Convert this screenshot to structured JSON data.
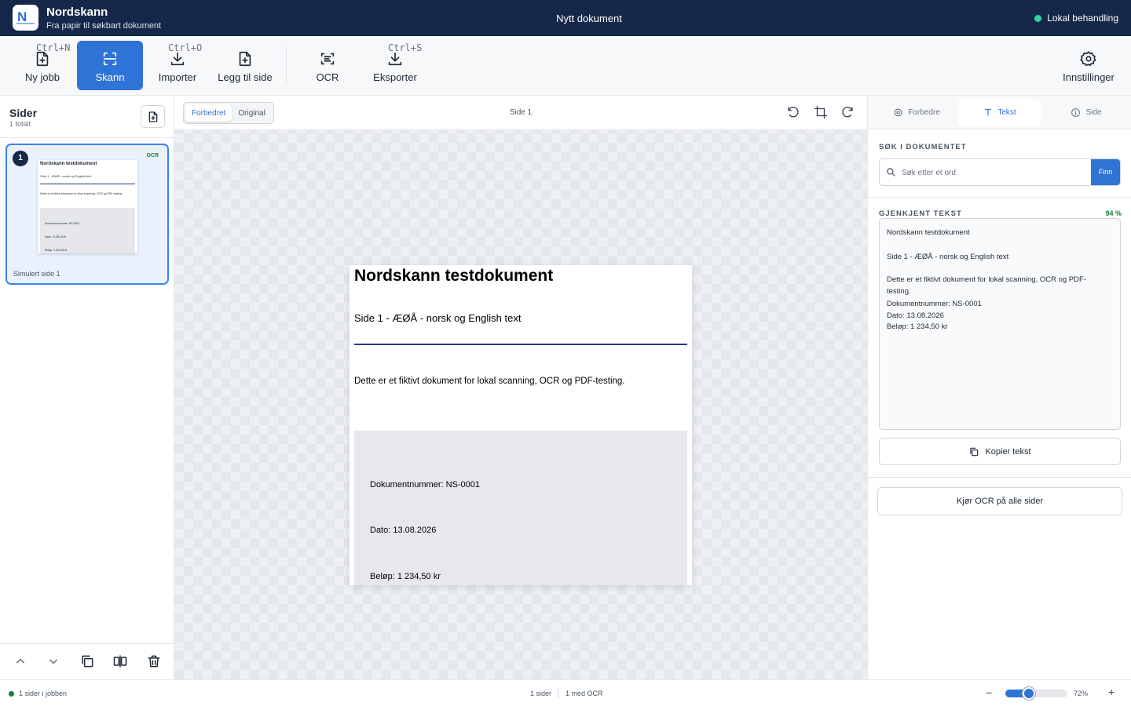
{
  "app": {
    "name": "Nordskann",
    "subtitle": "Fra papir til søkbart dokument",
    "logo_text": "N"
  },
  "document_title": "Nytt dokument",
  "local_status": "Lokal behandling",
  "colors": {
    "titlebar": "#16284a",
    "accent": "#2e73d6",
    "status_green": "#34d399",
    "ocr_badge": "#15803d"
  },
  "toolbar": {
    "new_job": {
      "label": "Ny jobb",
      "shortcut": "Ctrl+N",
      "icon": "file-plus-icon"
    },
    "scan": {
      "label": "Skann",
      "icon": "scan-icon",
      "active": true
    },
    "import": {
      "label": "Importer",
      "shortcut": "Ctrl+O",
      "icon": "download-icon"
    },
    "add_page": {
      "label": "Legg til side",
      "icon": "file-plus-icon"
    },
    "ocr": {
      "label": "OCR",
      "icon": "text-scan-icon"
    },
    "export": {
      "label": "Eksporter",
      "shortcut": "Ctrl+S",
      "icon": "download-icon"
    },
    "settings": {
      "label": "Innstillinger",
      "icon": "gear-icon"
    }
  },
  "pages_panel": {
    "title": "Sider",
    "count": "1 totalt",
    "pages": [
      {
        "number": "1",
        "badge": "OCR",
        "label": "Simulert side 1",
        "thumb_title": "Nordskann testdokument",
        "thumb_sub": "Side 1 - ÆØÅ - norsk og English text",
        "thumb_body": "Dette er et fiktivt dokument for lokal scanning, OCR og PDF-testing.",
        "thumb_doc": "Dokumentnummer: NS-0001",
        "thumb_date": "Dato: 13.08.2026",
        "thumb_amount": "Beløp: 1 234,50 kr"
      }
    ]
  },
  "viewer": {
    "views": [
      "Forbedret",
      "Original"
    ],
    "active_view": "Forbedret",
    "page_label": "Side 1",
    "document": {
      "title": "Nordskann testdokument",
      "subtitle": "Side 1 - ÆØÅ - norsk og English text",
      "body": "Dette er et fiktivt dokument for lokal scanning, OCR og PDF-testing.",
      "doc_number": "Dokumentnummer: NS-0001",
      "date": "Dato: 13.08.2026",
      "amount": "Beløp: 1 234,50 kr"
    }
  },
  "right_panel": {
    "tabs": [
      "Forbedre",
      "Tekst",
      "Side"
    ],
    "active_tab": "Tekst",
    "search_heading": "SØK I DOKUMENTET",
    "search_placeholder": "Søk etter et ord",
    "search_button": "Finn",
    "recognized_heading": "GJENKJENT TEKST",
    "confidence": "94 %",
    "ocr_text": {
      "l1": "Nordskann testdokument",
      "l2": "Side 1 - ÆØÅ - norsk og English text",
      "l3": "Dette er et fiktivt dokument for lokal scanning, OCR og PDF-",
      "l4": "testing.",
      "l5": "Dokumentnummer: NS-0001",
      "l6": "Dato: 13.08.2026",
      "l7": "Beløp: 1 234,50 kr"
    },
    "copy_button": "Kopier tekst",
    "run_all_button": "Kjør OCR på alle sider"
  },
  "status_bar": {
    "jobs": "1 sider i jobben",
    "pages": "1 sider",
    "ocr_pages": "1 med OCR",
    "zoom": "72%",
    "zoom_fraction": 0.38,
    "minus": "−",
    "plus": "+"
  }
}
